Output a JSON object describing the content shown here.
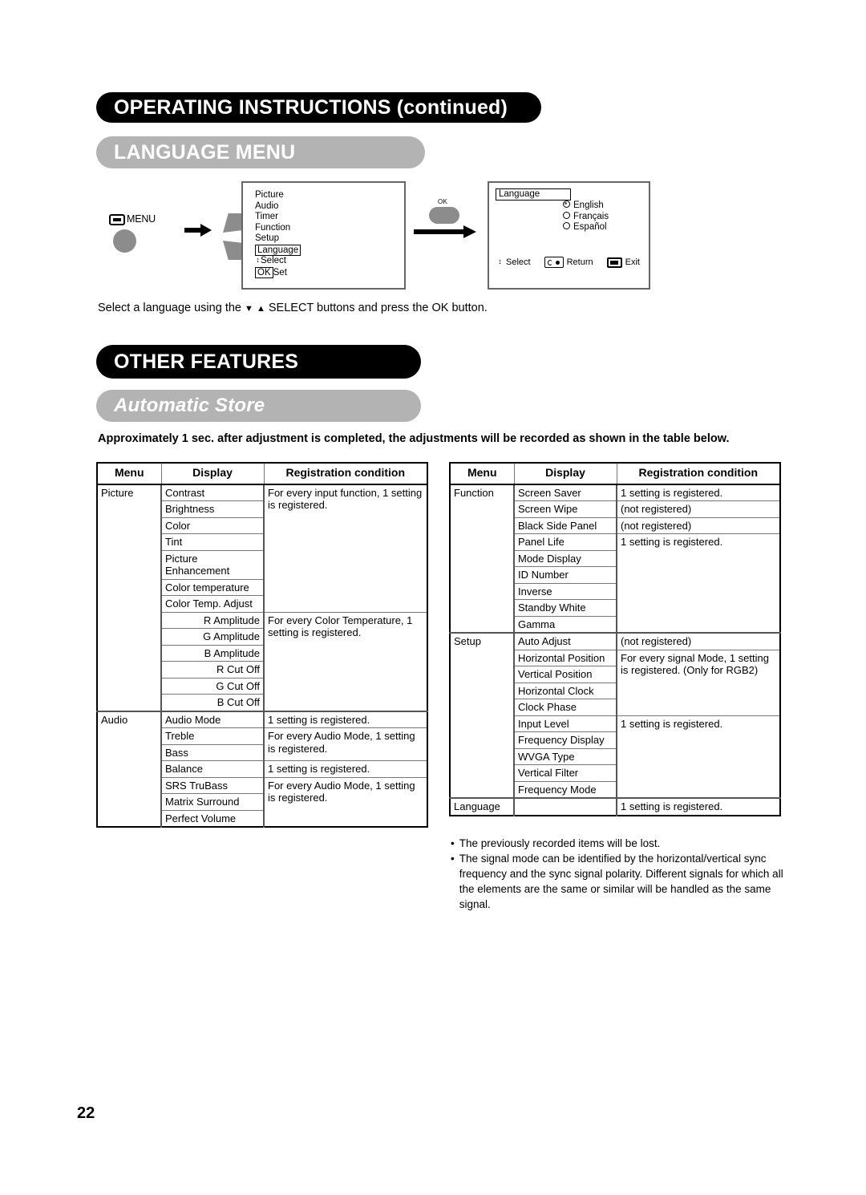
{
  "header": {
    "section_banner": "OPERATING INSTRUCTIONS (continued)",
    "subsection_banner": "LANGUAGE MENU",
    "other_features_banner": "OTHER FEATURES",
    "automatic_store_banner": "Automatic Store"
  },
  "diagram": {
    "menu_button_label": "MENU",
    "menu_icon": "menu-rect-icon",
    "select_pad_icon": "up-down-rocker-icon",
    "arrow_icon": "arrow-right-icon",
    "ok_button_label": "OK",
    "main_osd": {
      "items": [
        "Picture",
        "Audio",
        "Timer",
        "Function",
        "Setup"
      ],
      "highlighted_item": "Language",
      "hints": [
        {
          "icon": "up-down-arrows-icon",
          "label": "Select"
        },
        {
          "icon": "ok-key-icon",
          "key": "OK",
          "label": "Set"
        }
      ]
    },
    "language_osd": {
      "title": "Language",
      "options": [
        {
          "label": "English",
          "selected": true
        },
        {
          "label": "Français",
          "selected": false
        },
        {
          "label": "Español",
          "selected": false
        }
      ],
      "footer": [
        {
          "icon": "up-down-arrows-icon",
          "label": "Select"
        },
        {
          "icon": "return-key-icon",
          "label": "Return"
        },
        {
          "icon": "exit-key-icon",
          "label": "Exit"
        }
      ]
    }
  },
  "caption": {
    "before": "Select a language using the",
    "glyph_down": "▼",
    "glyph_up": "▲",
    "after": "SELECT buttons and press the OK button."
  },
  "automatic_store": {
    "intro": "Approximately 1 sec. after adjustment is completed, the adjustments will be recorded as shown in the table below."
  },
  "tables": {
    "headers": [
      "Menu",
      "Display",
      "Registration condition"
    ],
    "left": {
      "groups": [
        {
          "menu": "Picture",
          "blocks": [
            {
              "condition": "For every input function, 1 setting is registered.",
              "rows": [
                {
                  "display": "Contrast",
                  "align": "left"
                },
                {
                  "display": "Brightness",
                  "align": "left"
                },
                {
                  "display": "Color",
                  "align": "left"
                },
                {
                  "display": "Tint",
                  "align": "left"
                },
                {
                  "display": "Picture Enhancement",
                  "align": "left"
                },
                {
                  "display": "Color temperature",
                  "align": "left"
                },
                {
                  "display": "Color Temp. Adjust",
                  "align": "left"
                }
              ]
            },
            {
              "condition": "For every Color Temperature, 1 setting is registered.",
              "rows": [
                {
                  "display": "R Amplitude",
                  "align": "right"
                },
                {
                  "display": "G Amplitude",
                  "align": "right"
                },
                {
                  "display": "B Amplitude",
                  "align": "right"
                },
                {
                  "display": "R Cut Off",
                  "align": "right"
                },
                {
                  "display": "G Cut Off",
                  "align": "right"
                },
                {
                  "display": "B Cut Off",
                  "align": "right"
                }
              ]
            }
          ]
        },
        {
          "menu": "Audio",
          "blocks": [
            {
              "condition": "1 setting is registered.",
              "rows": [
                {
                  "display": "Audio Mode",
                  "align": "left"
                }
              ]
            },
            {
              "condition": "For every Audio Mode, 1 setting is registered.",
              "rows": [
                {
                  "display": "Treble",
                  "align": "left"
                },
                {
                  "display": "Bass",
                  "align": "left"
                }
              ]
            },
            {
              "condition": "1 setting is registered.",
              "rows": [
                {
                  "display": "Balance",
                  "align": "left"
                }
              ]
            },
            {
              "condition": "For every Audio Mode, 1 setting is registered.",
              "rows": [
                {
                  "display": "SRS TruBass",
                  "align": "left"
                },
                {
                  "display": "Matrix Surround",
                  "align": "left"
                },
                {
                  "display": "Perfect Volume",
                  "align": "left"
                }
              ]
            }
          ]
        }
      ]
    },
    "right": {
      "groups": [
        {
          "menu": "Function",
          "blocks": [
            {
              "condition": "1 setting is registered.",
              "rows": [
                {
                  "display": "Screen Saver",
                  "align": "left"
                }
              ]
            },
            {
              "condition": "(not registered)",
              "rows": [
                {
                  "display": "Screen Wipe",
                  "align": "left"
                }
              ]
            },
            {
              "condition": "(not registered)",
              "rows": [
                {
                  "display": "Black Side Panel",
                  "align": "left"
                }
              ]
            },
            {
              "condition": "1 setting is registered.",
              "rows": [
                {
                  "display": "Panel Life",
                  "align": "left"
                },
                {
                  "display": "Mode Display",
                  "align": "left"
                },
                {
                  "display": "ID Number",
                  "align": "left"
                },
                {
                  "display": "Inverse",
                  "align": "left"
                },
                {
                  "display": "Standby White",
                  "align": "left"
                },
                {
                  "display": "Gamma",
                  "align": "left"
                }
              ]
            }
          ]
        },
        {
          "menu": "Setup",
          "blocks": [
            {
              "condition": "(not registered)",
              "rows": [
                {
                  "display": "Auto Adjust",
                  "align": "left"
                }
              ]
            },
            {
              "condition": "For every signal Mode, 1 setting is registered. (Only for RGB2)",
              "rows": [
                {
                  "display": "Horizontal Position",
                  "align": "left"
                },
                {
                  "display": "Vertical Position",
                  "align": "left"
                },
                {
                  "display": "Horizontal Clock",
                  "align": "left"
                },
                {
                  "display": "Clock Phase",
                  "align": "left"
                }
              ]
            },
            {
              "condition": "1 setting is registered.",
              "rows": [
                {
                  "display": "Input Level",
                  "align": "left"
                },
                {
                  "display": "Frequency Display",
                  "align": "left"
                },
                {
                  "display": "WVGA Type",
                  "align": "left"
                },
                {
                  "display": "Vertical Filter",
                  "align": "left"
                },
                {
                  "display": "Frequency Mode",
                  "align": "left"
                }
              ]
            }
          ]
        },
        {
          "menu": "Language",
          "blocks": [
            {
              "condition": "1 setting is registered.",
              "rows": [
                {
                  "display": "",
                  "align": "left"
                }
              ]
            }
          ]
        }
      ]
    }
  },
  "notes": [
    "The previously recorded items will be lost.",
    "The signal mode can be identified by the horizontal/vertical sync frequency and the sync signal polarity. Different signals for which all the elements are the same or similar will be handled as the same signal."
  ],
  "page_number": "22",
  "colors": {
    "banner_black": "#000000",
    "banner_gray": "#b3b3b3",
    "remote_gray": "#8c8c8c",
    "table_border": "#777777"
  }
}
